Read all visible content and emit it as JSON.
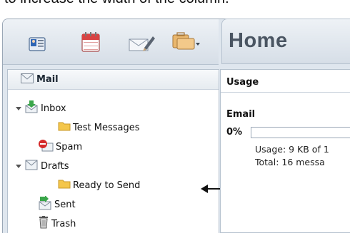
{
  "caption": "to increase the width of the column.",
  "toolbar": {
    "icons": [
      "contacts-icon",
      "calendar-icon",
      "compose-icon",
      "briefcase-icon"
    ]
  },
  "sidebar": {
    "header": "Mail",
    "folders": [
      {
        "label": "Inbox",
        "icon": "inbox-icon",
        "expanded": true
      },
      {
        "label": "Test Messages",
        "icon": "folder-icon"
      },
      {
        "label": "Spam",
        "icon": "spam-icon"
      },
      {
        "label": "Drafts",
        "icon": "drafts-icon",
        "expanded": true
      },
      {
        "label": "Ready to Send",
        "icon": "folder-icon"
      },
      {
        "label": "Sent",
        "icon": "sent-icon"
      },
      {
        "label": "Trash",
        "icon": "trash-icon"
      }
    ]
  },
  "main": {
    "title": "Home",
    "usage": {
      "title": "Usage",
      "section": "Email",
      "percent_label": "0%",
      "percent": 0,
      "line1": "Usage: 9 KB of 1",
      "line2": "Total: 16 messa"
    }
  },
  "colors": {
    "toolbar_top": "#eef2f6",
    "toolbar_bottom": "#d6dee7",
    "border": "#b6c2cf",
    "folder_yellow": "#f4c64a"
  }
}
